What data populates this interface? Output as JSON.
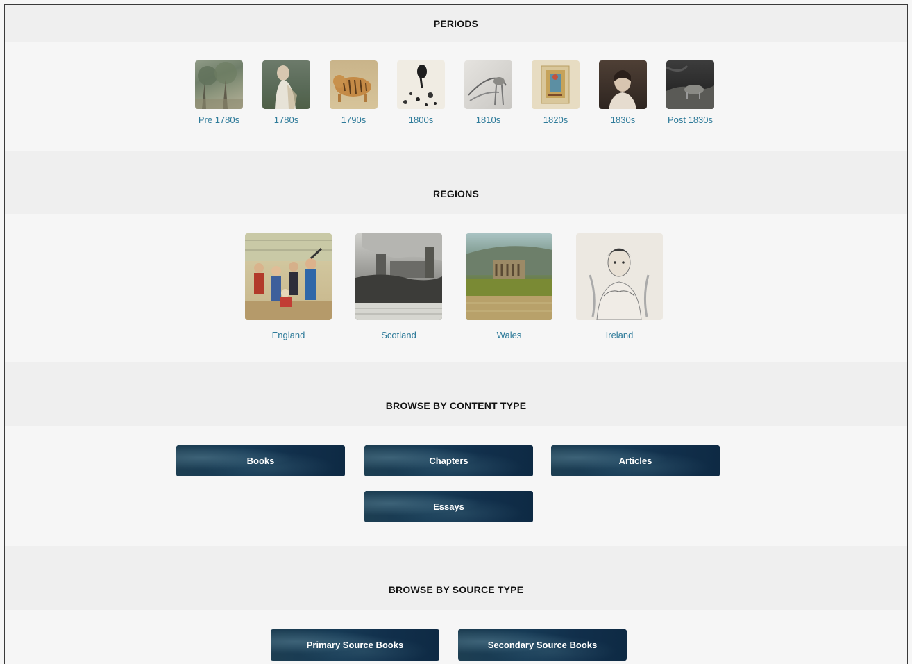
{
  "periods": {
    "heading": "PERIODS",
    "items": [
      {
        "label": "Pre 1780s",
        "icon": "landscape-trees-thumbnail"
      },
      {
        "label": "1780s",
        "icon": "portrait-figure-thumbnail"
      },
      {
        "label": "1790s",
        "icon": "tiger-illustration-thumbnail"
      },
      {
        "label": "1800s",
        "icon": "ink-sketch-thumbnail"
      },
      {
        "label": "1810s",
        "icon": "pencil-drawing-thumbnail"
      },
      {
        "label": "1820s",
        "icon": "illuminated-page-thumbnail"
      },
      {
        "label": "1830s",
        "icon": "portrait-woman-thumbnail"
      },
      {
        "label": "Post 1830s",
        "icon": "dark-etching-thumbnail"
      }
    ]
  },
  "regions": {
    "heading": "REGIONS",
    "items": [
      {
        "label": "England",
        "icon": "crowd-scene-thumbnail"
      },
      {
        "label": "Scotland",
        "icon": "castle-engraving-thumbnail"
      },
      {
        "label": "Wales",
        "icon": "abbey-landscape-thumbnail"
      },
      {
        "label": "Ireland",
        "icon": "portrait-sketch-thumbnail"
      }
    ]
  },
  "content_type": {
    "heading": "BROWSE BY CONTENT TYPE",
    "buttons": [
      "Books",
      "Chapters",
      "Articles",
      "Essays"
    ]
  },
  "source_type": {
    "heading": "BROWSE BY SOURCE TYPE",
    "buttons": [
      "Primary Source Books",
      "Secondary Source Books"
    ]
  },
  "colors": {
    "link": "#2d7a99",
    "button_bg": "#163a55",
    "band_bg": "#efefef",
    "page_bg": "#f6f6f6"
  }
}
